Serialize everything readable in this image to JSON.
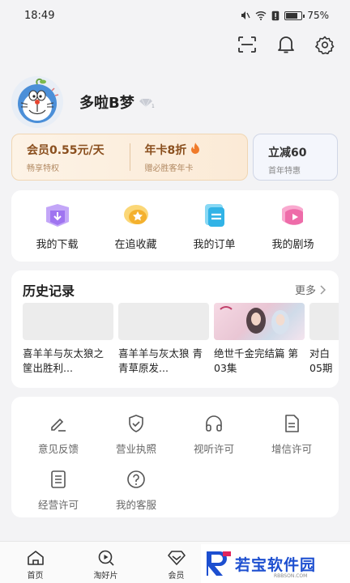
{
  "status_bar": {
    "time": "18:49",
    "battery": "75%"
  },
  "header_icons": [
    "scan-icon",
    "bell-icon",
    "settings-gear-icon"
  ],
  "profile": {
    "nickname": "多啦B梦"
  },
  "vip_card": {
    "left_main": "会员0.55元/天",
    "left_sub": "畅享特权",
    "right_main": "年卡8折",
    "right_sub": "赠必胜客年卡"
  },
  "promo_card": {
    "main": "立减60",
    "sub": "首年特惠"
  },
  "quick_actions": [
    {
      "label": "我的下载",
      "icon": "download-icon",
      "color": "#b48df5"
    },
    {
      "label": "在追收藏",
      "icon": "star-icon",
      "color": "#f5b945"
    },
    {
      "label": "我的订单",
      "icon": "order-icon",
      "color": "#3fb8e8"
    },
    {
      "label": "我的剧场",
      "icon": "theater-play-icon",
      "color": "#f07bb3"
    }
  ],
  "history": {
    "title": "历史记录",
    "more": "更多",
    "items": [
      {
        "title": "喜羊羊与灰太狼之筐出胜利..."
      },
      {
        "title": "喜羊羊与灰太狼 青青草原发..."
      },
      {
        "title": "绝世千金完结篇 第03集"
      },
      {
        "title": "对白05期"
      }
    ]
  },
  "services": [
    {
      "label": "意见反馈",
      "icon": "pen-feedback-icon"
    },
    {
      "label": "营业执照",
      "icon": "shield-check-icon"
    },
    {
      "label": "视听许可",
      "icon": "headphones-icon"
    },
    {
      "label": "增信许可",
      "icon": "document-icon"
    },
    {
      "label": "经营许可",
      "icon": "list-document-icon"
    },
    {
      "label": "我的客服",
      "icon": "help-question-icon"
    }
  ],
  "tabbar": [
    {
      "label": "首页",
      "icon": "home-icon"
    },
    {
      "label": "淘好片",
      "icon": "search-play-icon"
    },
    {
      "label": "会员",
      "icon": "vip-diamond-icon"
    }
  ],
  "watermark": {
    "text": "若宝软件园",
    "sub": "RBBSON.COM"
  },
  "colors": {
    "accent_vip": "#8a4f1e",
    "background": "#f3f3f5",
    "watermark": "#1d4fd0"
  }
}
